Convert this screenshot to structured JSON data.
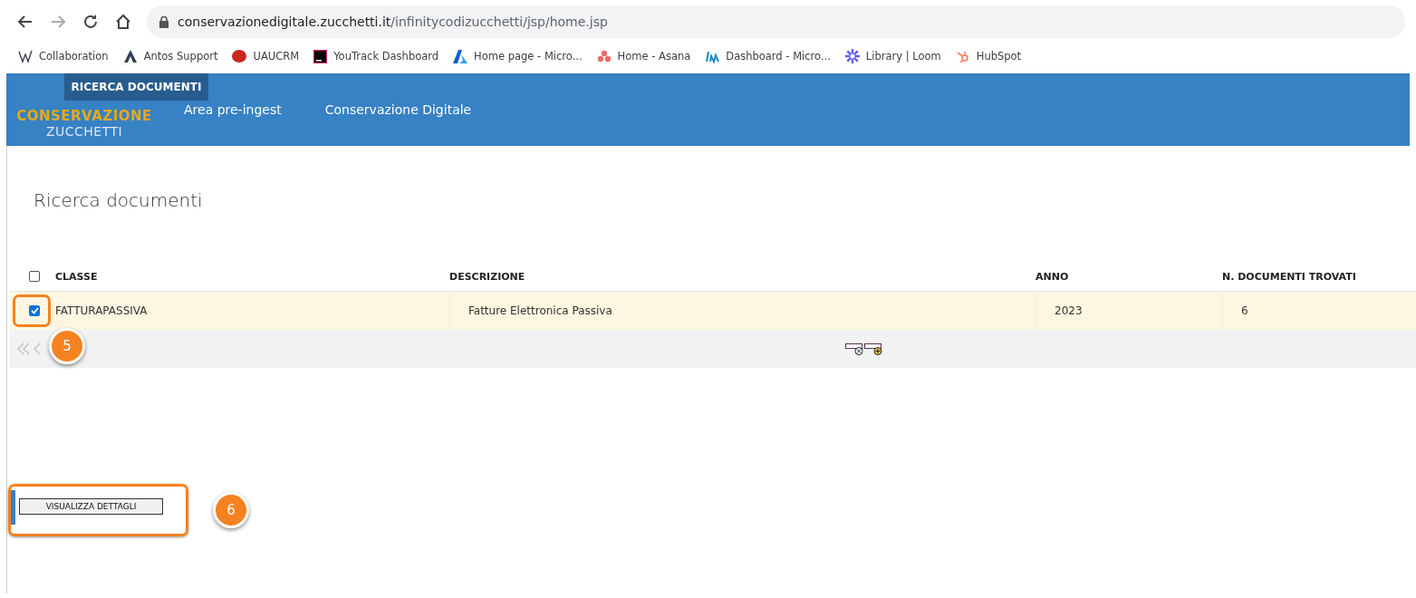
{
  "browser": {
    "url_host": "conservazionedigitale.zucchetti.it",
    "url_path": "/infinitycodizucchetti/jsp/home.jsp",
    "bookmarks": [
      {
        "kind": "w",
        "label": "Collaboration"
      },
      {
        "kind": "a",
        "label": "Antos Support"
      },
      {
        "kind": "crm",
        "label": "UAUCRM"
      },
      {
        "kind": "yt",
        "label": "YouTrack Dashboard"
      },
      {
        "kind": "azure",
        "label": "Home page - Micro..."
      },
      {
        "kind": "asana",
        "label": "Home - Asana"
      },
      {
        "kind": "dash",
        "label": "Dashboard - Micro..."
      },
      {
        "kind": "loom",
        "label": "Library | Loom"
      },
      {
        "kind": "hubspot",
        "label": "HubSpot"
      }
    ]
  },
  "header": {
    "logo_top": "CONSERVAZIONE",
    "logo_bottom": "ZUCCHETTI",
    "active_menu": "RICERCA DOCUMENTI",
    "nav": [
      {
        "label": "Area pre-ingest"
      },
      {
        "label": "Conservazione Digitale"
      }
    ]
  },
  "page_title": "Ricerca documenti",
  "table": {
    "select_all": {
      "checked": false
    },
    "columns": [
      "CLASSE",
      "DESCRIZIONE",
      "ANNO",
      "N. DOCUMENTI TROVATI"
    ],
    "rows": [
      {
        "checked": true,
        "cells": [
          "FATTURAPASSIVA",
          "Fatture Elettronica Passiva",
          "2023",
          "6"
        ]
      }
    ]
  },
  "details_button": "VISUALIZZA DETTAGLI",
  "callouts": [
    {
      "number": "5"
    },
    {
      "number": "6"
    }
  ]
}
